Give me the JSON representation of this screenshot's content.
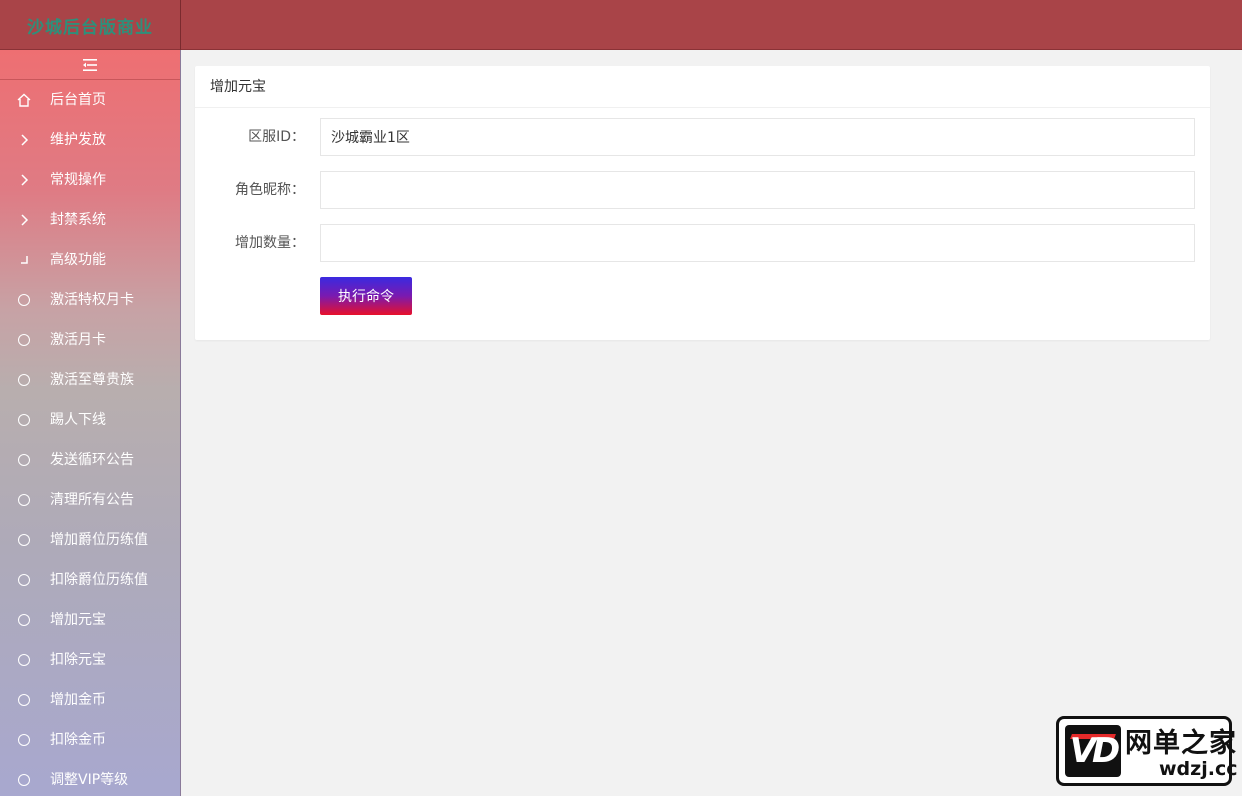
{
  "app": {
    "title": "沙城后台版商业"
  },
  "sidebar": {
    "items": [
      {
        "label": "后台首页",
        "icon": "home-icon"
      },
      {
        "label": "维护发放",
        "icon": "chevron-right-icon"
      },
      {
        "label": "常规操作",
        "icon": "chevron-right-icon"
      },
      {
        "label": "封禁系统",
        "icon": "chevron-right-icon"
      },
      {
        "label": "高级功能",
        "icon": "expanded-icon"
      },
      {
        "label": "激活特权月卡",
        "icon": "circle-icon"
      },
      {
        "label": "激活月卡",
        "icon": "circle-icon"
      },
      {
        "label": "激活至尊贵族",
        "icon": "circle-icon"
      },
      {
        "label": "踢人下线",
        "icon": "circle-icon"
      },
      {
        "label": "发送循环公告",
        "icon": "circle-icon"
      },
      {
        "label": "清理所有公告",
        "icon": "circle-icon"
      },
      {
        "label": "增加爵位历练值",
        "icon": "circle-icon"
      },
      {
        "label": "扣除爵位历练值",
        "icon": "circle-icon"
      },
      {
        "label": "增加元宝",
        "icon": "circle-icon"
      },
      {
        "label": "扣除元宝",
        "icon": "circle-icon"
      },
      {
        "label": "增加金币",
        "icon": "circle-icon"
      },
      {
        "label": "扣除金币",
        "icon": "circle-icon"
      },
      {
        "label": "调整VIP等级",
        "icon": "circle-icon"
      }
    ]
  },
  "panel": {
    "title": "增加元宝",
    "fields": [
      {
        "label": "区服ID：",
        "value": "沙城霸业1区",
        "placeholder": ""
      },
      {
        "label": "角色昵称：",
        "value": "",
        "placeholder": ""
      },
      {
        "label": "增加数量：",
        "value": "",
        "placeholder": ""
      }
    ],
    "submit_label": "执行命令"
  },
  "watermark": {
    "title": "网单之家",
    "url": "wdzj.cc"
  },
  "colors": {
    "topbar": "#a94448",
    "button_top": "#3a2ae0",
    "button_bottom": "#e8102a"
  }
}
